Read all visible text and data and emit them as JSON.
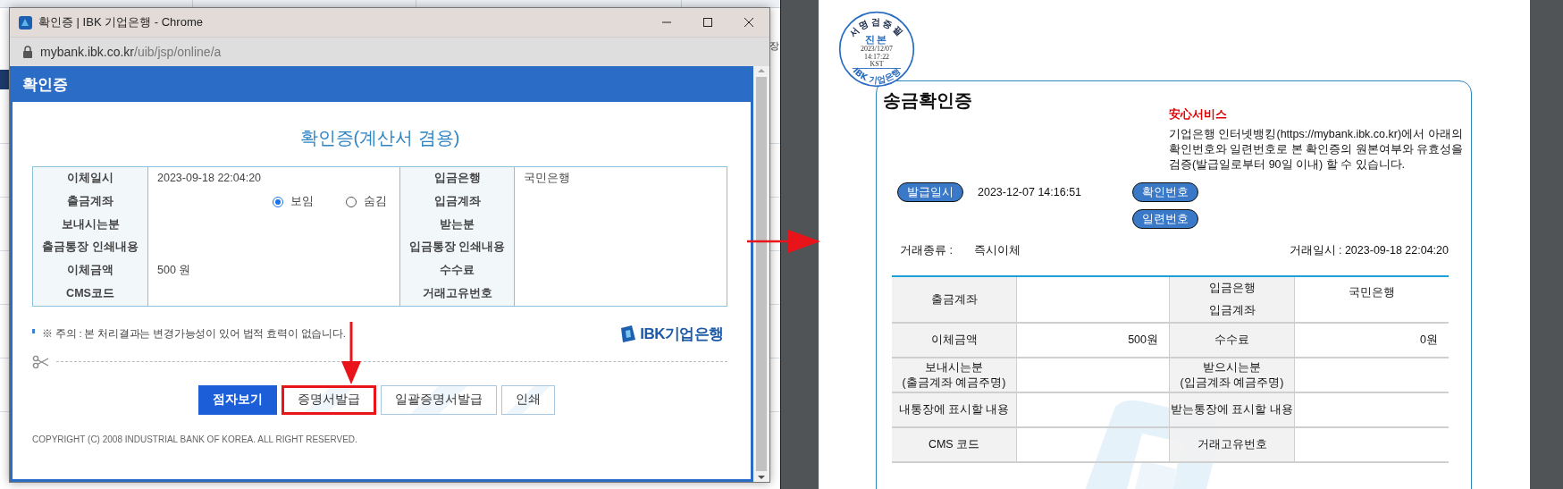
{
  "background_page": {
    "side_text": "장"
  },
  "popup": {
    "window_title": "확인증 | IBK 기업은행 - Chrome",
    "address": {
      "host": "mybank.ibk.co.kr",
      "path": "/uib/jsp/online/a"
    },
    "header": "확인증",
    "title": "확인증(계산서 겸용)",
    "table": {
      "rows": [
        {
          "label": "이체일시",
          "value": "2023-09-18 22:04:20",
          "label_2": "입금은행",
          "value_2": "국민은행"
        },
        {
          "label": "출금계좌",
          "radios": [
            {
              "label": "보임",
              "selected": true
            },
            {
              "label": "숨김",
              "selected": false
            }
          ],
          "label_2": "입금계좌"
        },
        {
          "label": "보내시는분",
          "label_2": "받는분"
        },
        {
          "label": "출금통장 인쇄내용",
          "label_2": "입금통장 인쇄내용"
        },
        {
          "label": "이체금액",
          "value": "500 원",
          "label_2": "수수료"
        },
        {
          "label": "CMS코드",
          "label_2": "거래고유번호"
        }
      ]
    },
    "notice": "※ 주의 : 본 처리결과는 변경가능성이 있어 법적 효력이 없습니다.",
    "logo_text": "IBK기업은행",
    "buttons": [
      {
        "label": "점자보기",
        "kind": "primary",
        "highlighted": false
      },
      {
        "label": "증명서발급",
        "kind": "secondary",
        "highlighted": true
      },
      {
        "label": "일괄증명서발급",
        "kind": "secondary",
        "highlighted": false
      },
      {
        "label": "인쇄",
        "kind": "secondary",
        "highlighted": false
      }
    ],
    "copyright": "COPYRIGHT (C) 2008 INDUSTRIAL BANK OF KOREA. ALL RIGHT RESERVED."
  },
  "document": {
    "stamp": {
      "top": "서명검증필",
      "center": "진본",
      "date": "2023/12/07",
      "time": "14:17:22",
      "zone": "KST",
      "bottom": "IBK 기업은행"
    },
    "title": "송금확인증",
    "service_title": "安心서비스",
    "service_text": "기업은행 인터넷뱅킹(https://mybank.ibk.co.kr)에서 아래의 확인번호와 일련번호로 본 확인증의 원본여부와 유효성을 검증(발급일로부터 90일 이내) 할 수 있습니다.",
    "issue": {
      "label": "발급일시",
      "value": "2023-12-07 14:16:51"
    },
    "number_labels": [
      "확인번호",
      "일련번호"
    ],
    "type": {
      "label": "거래종류 :",
      "value": "즉시이체"
    },
    "datetime": "거래일시 : 2023-09-18 22:04:20",
    "table": {
      "rows": [
        {
          "labels": [
            "출금계좌"
          ],
          "labels_2": [
            "입금은행",
            "입금계좌"
          ],
          "value_2": "국민은행"
        },
        {
          "labels": [
            "이체금액"
          ],
          "value": "500원",
          "labels_2": [
            "수수료"
          ],
          "value_2": "0원"
        },
        {
          "labels": [
            "보내시는분",
            "(출금계좌 예금주명)"
          ],
          "labels_2": [
            "받으시는분",
            "(입금계좌 예금주명)"
          ]
        },
        {
          "labels": [
            "내통장에 표시할 내용"
          ],
          "labels_2": [
            "받는통장에 표시할 내용"
          ]
        },
        {
          "labels": [
            "CMS 코드"
          ],
          "labels_2": [
            "거래고유번호"
          ]
        }
      ]
    }
  }
}
